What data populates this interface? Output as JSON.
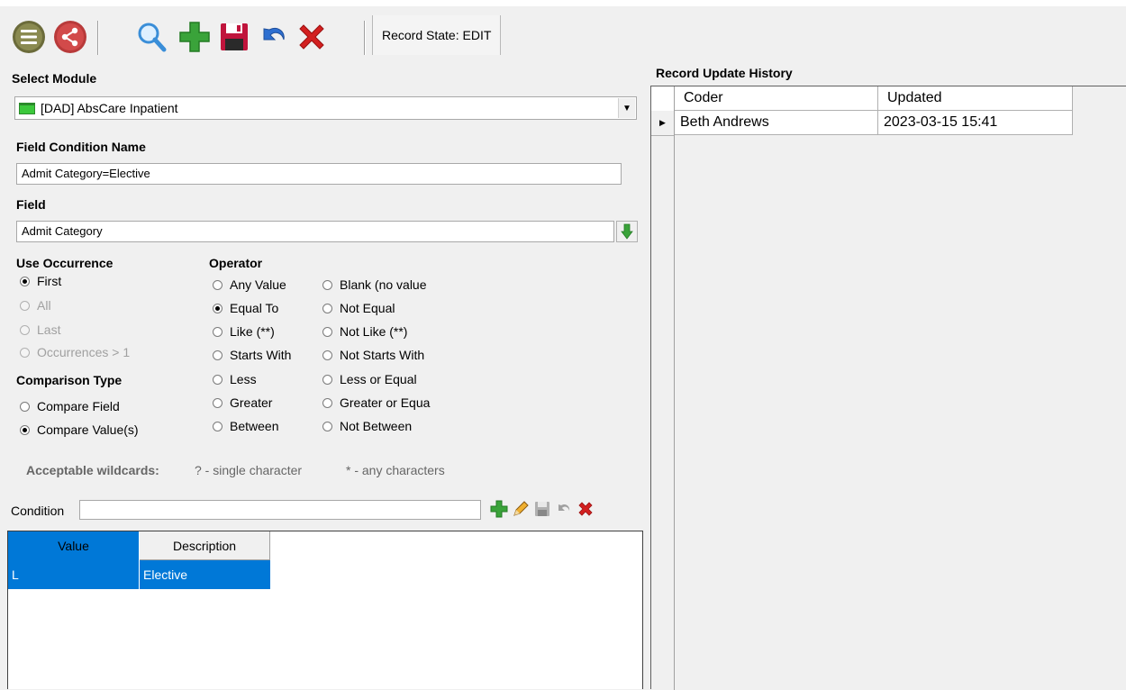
{
  "toolbar": {
    "record_state_label": "Record State: EDIT",
    "buttons": [
      "list-icon",
      "share-icon",
      "search-icon",
      "add-icon",
      "save-icon",
      "undo-icon",
      "delete-icon"
    ]
  },
  "module": {
    "label": "Select Module",
    "value": "[DAD] AbsCare Inpatient"
  },
  "field_condition": {
    "label": "Field Condition Name",
    "value": "Admit Category=Elective"
  },
  "field": {
    "label": "Field",
    "value": "Admit Category"
  },
  "use_occurrence": {
    "label": "Use Occurrence",
    "options": [
      {
        "label": "First",
        "selected": true,
        "enabled": true
      },
      {
        "label": "All",
        "selected": false,
        "enabled": false
      },
      {
        "label": "Last",
        "selected": false,
        "enabled": false
      },
      {
        "label": "Occurrences > 1",
        "selected": false,
        "enabled": false
      }
    ]
  },
  "operator": {
    "label": "Operator",
    "left": [
      {
        "label": "Any Value",
        "selected": false
      },
      {
        "label": "Equal To",
        "selected": true
      },
      {
        "label": "Like (**)",
        "selected": false
      },
      {
        "label": "Starts With",
        "selected": false
      },
      {
        "label": "Less",
        "selected": false
      },
      {
        "label": "Greater",
        "selected": false
      },
      {
        "label": "Between",
        "selected": false
      }
    ],
    "right": [
      {
        "label": "Blank (no value",
        "selected": false
      },
      {
        "label": "Not Equal",
        "selected": false
      },
      {
        "label": "Not Like (**)",
        "selected": false
      },
      {
        "label": "Not Starts With",
        "selected": false
      },
      {
        "label": "Less or Equal",
        "selected": false
      },
      {
        "label": "Greater or Equa",
        "selected": false
      },
      {
        "label": "Not Between",
        "selected": false
      }
    ]
  },
  "comparison": {
    "label": "Comparison Type",
    "options": [
      {
        "label": "Compare Field",
        "selected": false
      },
      {
        "label": "Compare Value(s)",
        "selected": true
      }
    ]
  },
  "wildcards": {
    "label": "Acceptable wildcards:",
    "single": "? -  single character",
    "any": "* - any characters"
  },
  "condition": {
    "label": "Condition",
    "value": ""
  },
  "values_grid": {
    "columns": [
      "Value",
      "Description"
    ],
    "rows": [
      {
        "value": "L",
        "description": "Elective"
      }
    ]
  },
  "history": {
    "label": "Record Update History",
    "columns": [
      "Coder",
      "Updated"
    ],
    "rows": [
      {
        "coder": "Beth Andrews",
        "updated": "2023-03-15 15:41"
      }
    ]
  },
  "colors": {
    "selection": "#0078d7",
    "delete": "#d32020",
    "add": "#3aa33a",
    "save": "#c0143c"
  }
}
